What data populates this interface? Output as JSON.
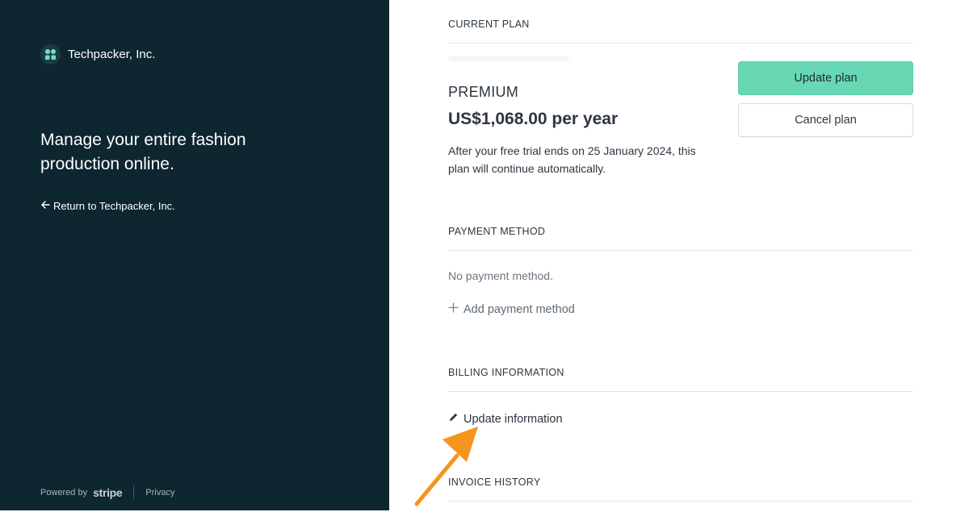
{
  "sidebar": {
    "brand_name": "Techpacker, Inc.",
    "tagline": "Manage your entire fashion production online.",
    "return_link": "Return to Techpacker, Inc.",
    "footer": {
      "powered_by": "Powered by",
      "stripe": "stripe",
      "privacy": "Privacy"
    }
  },
  "current_plan": {
    "title": "CURRENT PLAN",
    "plan_name": "PREMIUM",
    "price": "US$1,068.00 per year",
    "note": "After your free trial ends on 25 January 2024, this plan will continue automatically.",
    "update_button": "Update plan",
    "cancel_button": "Cancel plan"
  },
  "payment_method": {
    "title": "PAYMENT METHOD",
    "empty_text": "No payment method.",
    "add_link": "Add payment method"
  },
  "billing_information": {
    "title": "BILLING INFORMATION",
    "update_link": "Update information"
  },
  "invoice_history": {
    "title": "INVOICE HISTORY"
  },
  "colors": {
    "sidebar_bg": "#0d2630",
    "accent": "#68d8b4",
    "annotation_arrow": "#f7941d"
  },
  "icons": {
    "logo": "techpacker-logo-icon",
    "back": "arrow-left-icon",
    "add": "plus-icon",
    "edit": "pencil-icon",
    "annotation": "annotation-arrow-icon"
  }
}
